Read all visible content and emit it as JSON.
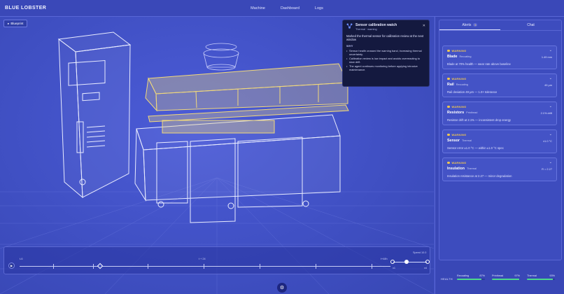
{
  "app": {
    "brand": "BLUE LOBSTER"
  },
  "nav": {
    "items": [
      "Machine",
      "Dashboard",
      "Logs"
    ]
  },
  "viewport": {
    "blueprint_label": "Blueprint"
  },
  "popup": {
    "title": "Sensor calibration watch",
    "subtitle": "Thermal · warning",
    "description": "Marked the thermal sensor for calibration review at the next window",
    "why_label": "WHY",
    "reasons": [
      "Sensor health crossed the warning band, increasing thermal uncertainty.",
      "Calibration review is low impact and avoids overreacting to slow drift.",
      "The agent continues monitoring before applying intrusive maintenance."
    ]
  },
  "timeline": {
    "start_label": "t-6",
    "mid_label": "t + 24",
    "end_label": "t+48h",
    "speed_label": "Speed 10.0",
    "speed_min": "x1",
    "speed_max": "x4"
  },
  "sidebar": {
    "tabs": [
      {
        "label": "Alerts",
        "badge": "5",
        "active": true
      },
      {
        "label": "Chat",
        "active": false
      }
    ],
    "alerts": [
      {
        "level": "WARNING",
        "name": "Blade",
        "category": "Recoating",
        "value": "1.49 mm",
        "description": "Blade at 70% health — wear rate above baseline"
      },
      {
        "level": "WARNING",
        "name": "Rail",
        "category": "Recoating",
        "value": "49 µm",
        "description": "Rail deviation 49 µm — 1.0× tolerance"
      },
      {
        "level": "WARNING",
        "name": "Resistors",
        "category": "Printhead",
        "value": "2.1% drift",
        "description": "Resistor drift at 2.1% — inconsistent drop energy"
      },
      {
        "level": "WARNING",
        "name": "Sensor",
        "category": "Thermal",
        "value": "±1.0 °C",
        "description": "Sensor error ±1.0 °C — within ±1.0 °C spec"
      },
      {
        "level": "WARNING",
        "name": "Insulation",
        "category": "Thermal",
        "value": "R = 2.27",
        "description": "Insulation resistance at 2.27 — minor degradation"
      }
    ],
    "health": {
      "label": "HEALTH",
      "items": [
        {
          "name": "Recoating",
          "percent": "87%",
          "value": 0.87
        },
        {
          "name": "Printhead",
          "percent": "97%",
          "value": 0.97
        },
        {
          "name": "Thermal",
          "percent": "93%",
          "value": 0.93
        }
      ]
    }
  },
  "colors": {
    "background": "#3f4fc2",
    "warning": "#f6c94a",
    "health": "#4ed98a",
    "highlight": "#f2d97a"
  }
}
